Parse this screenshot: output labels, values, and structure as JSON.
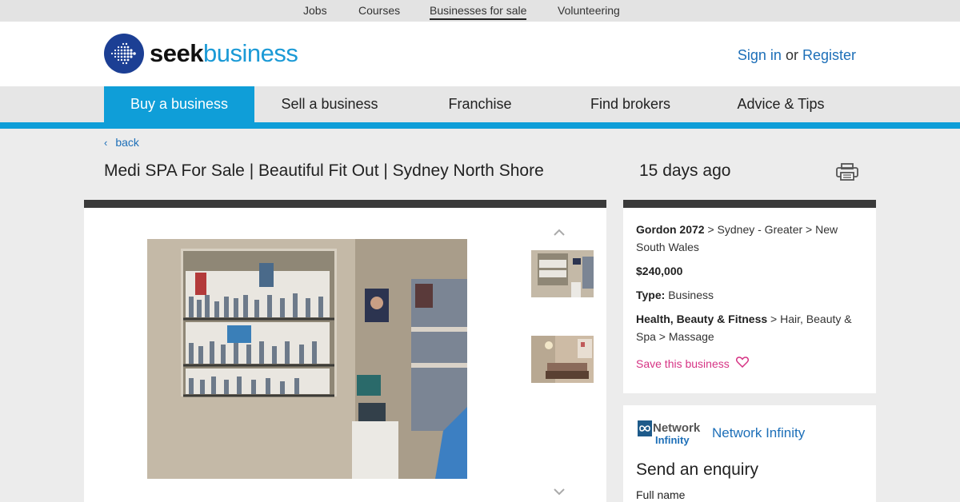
{
  "topbar": {
    "links": [
      "Jobs",
      "Courses",
      "Businesses for sale",
      "Volunteering"
    ]
  },
  "header": {
    "logo_seek": "seek",
    "logo_business": "business",
    "sign_in": "Sign in",
    "or": "or",
    "register": "Register"
  },
  "nav": {
    "items": [
      "Buy a business",
      "Sell a business",
      "Franchise",
      "Find brokers",
      "Advice & Tips"
    ]
  },
  "listing": {
    "back": "back",
    "title": "Medi SPA For Sale | Beautiful Fit Out | Sydney North Shore",
    "posted": "15 days ago"
  },
  "info": {
    "suburb": "Gordon 2072",
    "location_rest": " > Sydney - Greater > New South Wales",
    "price": "$240,000",
    "type_label": "Type:",
    "type_value": " Business",
    "category": "Health, Beauty & Fitness",
    "category_rest": " > Hair, Beauty & Spa > Massage",
    "save": "Save this business"
  },
  "agent": {
    "logo_line1": "Network",
    "logo_line2": "Infinity",
    "name": "Network Infinity",
    "enquiry_title": "Send an enquiry",
    "full_name_label": "Full name"
  },
  "colors": {
    "accent": "#0f9ed8",
    "link": "#1d6fb8",
    "save": "#d63384",
    "dark_bar": "#3a3a3a"
  }
}
